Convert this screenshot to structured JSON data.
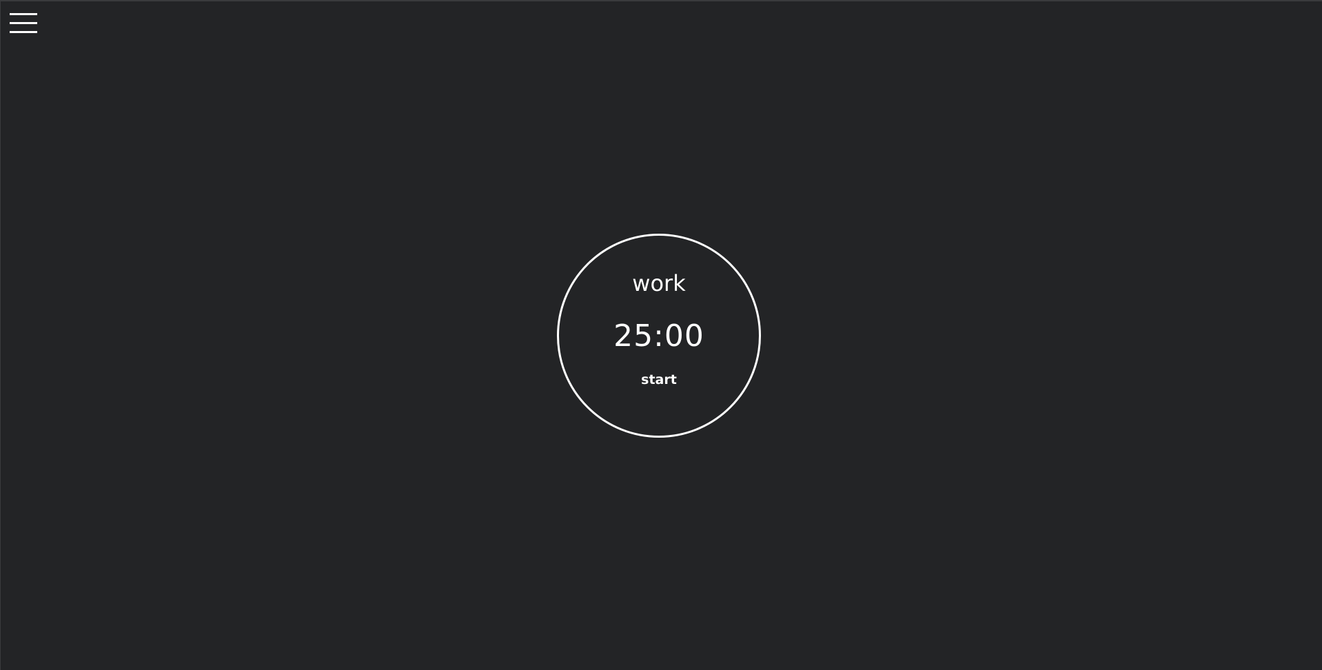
{
  "menu": {
    "icon": "hamburger-menu-icon"
  },
  "timer": {
    "mode": "work",
    "time": "25:00",
    "action_label": "start"
  },
  "colors": {
    "background": "#232426",
    "foreground": "#ffffff"
  }
}
